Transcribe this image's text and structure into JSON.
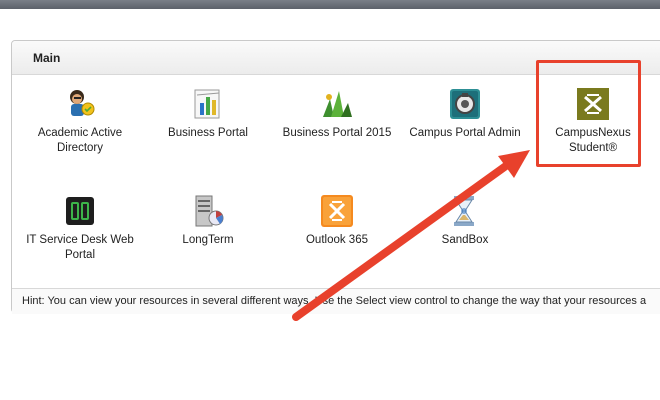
{
  "section_title": "Main",
  "resources": [
    {
      "label": "Academic Active Directory",
      "icon": "user-avatar-icon"
    },
    {
      "label": "Business Portal",
      "icon": "business-chart-icon"
    },
    {
      "label": "Business Portal 2015",
      "icon": "business-chart-2015-icon"
    },
    {
      "label": "Campus Portal Admin",
      "icon": "campus-admin-icon"
    },
    {
      "label": "CampusNexus Student®",
      "icon": "campusnexus-logo-icon"
    },
    {
      "label": "IT Service Desk Web Portal",
      "icon": "service-desk-icon"
    },
    {
      "label": "LongTerm",
      "icon": "server-icon"
    },
    {
      "label": "Outlook 365",
      "icon": "outlook-icon"
    },
    {
      "label": "SandBox",
      "icon": "sandbox-icon"
    }
  ],
  "hint": "Hint: You can view your resources in several different ways. Use the Select view control to change the way that your resources a",
  "colors": {
    "highlight": "#e8412c",
    "nexus_green": "#7a7a1e",
    "outlook_orange": "#f58a1f"
  }
}
